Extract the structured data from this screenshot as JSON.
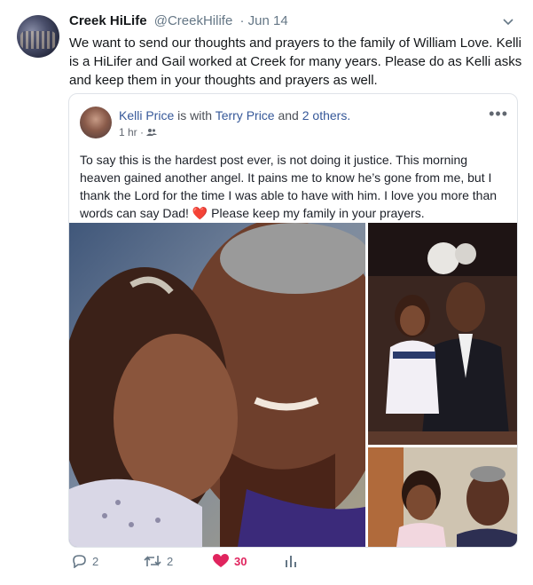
{
  "tweet": {
    "display_name": "Creek HiLife",
    "handle": "@CreekHilife",
    "date": "· Jun 14",
    "text": "We want to send our thoughts and prayers to the family of William Love. Kelli is a HiLifer and Gail worked at Creek for many years. Please do as Kelli asks and keep them in your thoughts and prayers as well."
  },
  "embed": {
    "author": "Kelli Price",
    "with_text": "is with",
    "tagged": "Terry Price",
    "and_text": "and",
    "others": "2 others.",
    "time": "1 hr ·",
    "privacy_icon": "friends-icon",
    "more_label": "•••",
    "text_before_heart": "To say this is the hardest post ever, is not doing it justice. This morning heaven gained another angel. It pains me to know he’s gone from me, but I thank the Lord for the time I was able to have with him. I love you more than words can say Dad!",
    "heart": "❤️",
    "text_after_heart": "Please keep my family in your prayers."
  },
  "actions": {
    "reply_count": "2",
    "retweet_count": "2",
    "like_count": "30",
    "like_color": "#e0245e"
  }
}
